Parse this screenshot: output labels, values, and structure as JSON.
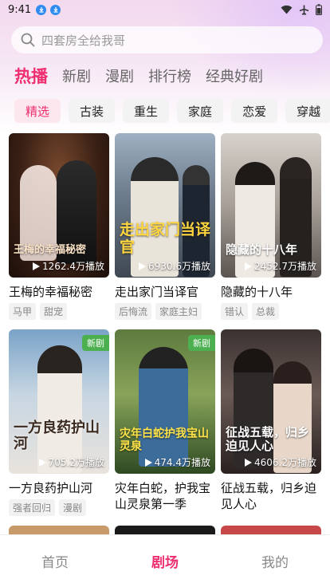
{
  "status": {
    "time": "9:41"
  },
  "search": {
    "placeholder": "四套房全给我哥"
  },
  "main_tabs": [
    "热播",
    "新剧",
    "漫剧",
    "排行榜",
    "经典好剧"
  ],
  "chips": [
    "精选",
    "古装",
    "重生",
    "家庭",
    "恋爱",
    "穿越"
  ],
  "cards": [
    {
      "cover_title": "王梅的幸福秘密",
      "plays": "1262.4万播放",
      "title": "王梅的幸福秘密",
      "tags": [
        "马甲",
        "甜宠"
      ],
      "is_new": false
    },
    {
      "cover_title": "走出家门当译官",
      "plays": "6930.6万播放",
      "title": "走出家门当译官",
      "tags": [
        "后悔流",
        "家庭主妇"
      ],
      "is_new": false
    },
    {
      "cover_title": "隐藏的十八年",
      "plays": "2452.7万播放",
      "title": "隐藏的十八年",
      "tags": [
        "错认",
        "总裁"
      ],
      "is_new": false
    },
    {
      "cover_title": "一方良药护山河",
      "plays": "705.2万播放",
      "title": "一方良药护山河",
      "tags": [
        "强者回归",
        "漫剧"
      ],
      "is_new": true,
      "new_label": "新剧"
    },
    {
      "cover_title": "灾年白蛇护我宝山灵泉",
      "plays": "474.4万播放",
      "title": "灾年白蛇，护我宝山灵泉第一季",
      "tags": [],
      "is_new": true,
      "new_label": "新剧"
    },
    {
      "cover_title": "征战五载，归乡迫见人心",
      "plays": "4606.2万播放",
      "title": "征战五载，归乡迫见人心",
      "tags": [],
      "is_new": false
    }
  ],
  "bottom_nav": [
    "首页",
    "剧场",
    "我的"
  ],
  "colors": {
    "accent": "#ee2e6f",
    "new_badge": "#4caf50"
  }
}
